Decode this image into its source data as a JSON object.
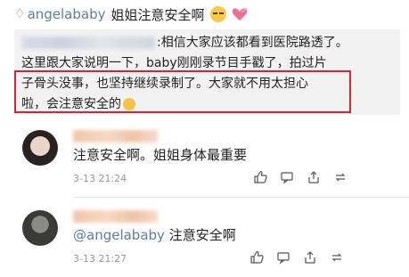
{
  "post": {
    "author": "angelababy",
    "text": "姐姐注意安全啊"
  },
  "quote": {
    "line1_suffix": ":相信大家应该都看到医院路透了。",
    "line2": "这里跟大家说明一下，baby刚刚录节目手戳了，拍过片",
    "line3": "子骨头没事，也坚持继续录制了。大家就不用太担心",
    "line4": "啦，会注意安全的"
  },
  "comments": [
    {
      "text": "注意安全啊。姐姐身体最重要",
      "mention": "",
      "time": "3-13 21:24"
    },
    {
      "text": " 注意安全啊",
      "mention": "@angelababy",
      "time": "3-13 21:27"
    }
  ],
  "icons": [
    "diamond-icon",
    "unamused-emoji-icon",
    "heart-icon",
    "smile-emoji-icon",
    "like-icon",
    "reply-icon",
    "share-icon",
    "repost-icon"
  ]
}
